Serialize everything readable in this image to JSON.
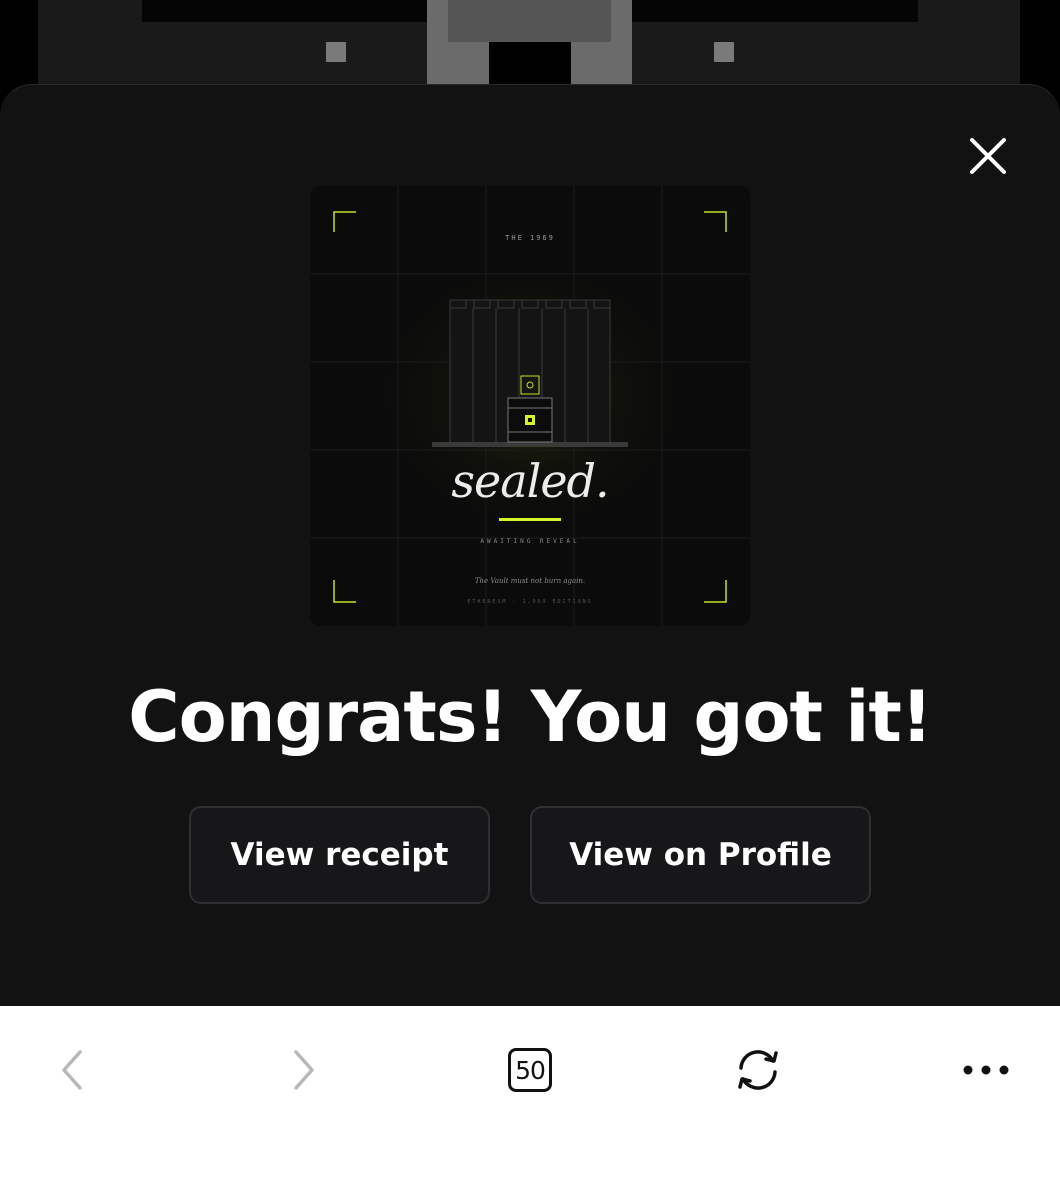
{
  "modal": {
    "headline": "Congrats! You got it!",
    "actions": {
      "view_receipt": "View receipt",
      "view_profile": "View on Profile"
    }
  },
  "artwork": {
    "eyebrow": "THE 1969",
    "title": "sealed.",
    "subtitle": "AWAITING REVEAL",
    "tagline": "The Vault must not burn again.",
    "footer": "ETHEREUM · 1,969 EDITIONS",
    "accent_color": "#d6f22a"
  },
  "toolbar": {
    "tab_count": "50",
    "icons": [
      "chevron-left-icon",
      "chevron-right-icon",
      "tabs-icon",
      "refresh-icon",
      "more-icon"
    ]
  }
}
